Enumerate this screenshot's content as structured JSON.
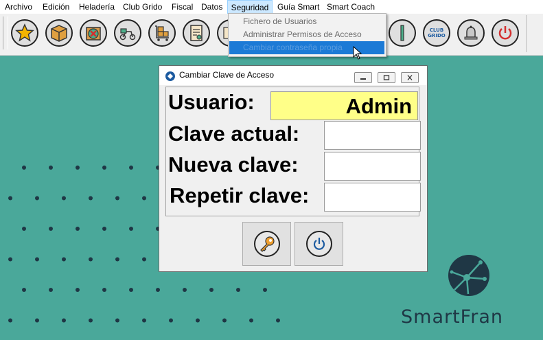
{
  "menu": {
    "items": [
      "Archivo",
      "Edición",
      "Heladería",
      "Club Grido",
      "Fiscal",
      "Datos",
      "Seguridad",
      "Guía Smart",
      "Smart Coach"
    ],
    "active": "Seguridad"
  },
  "seguridad_menu": {
    "items": [
      "Fichero de Usuarios",
      "Administrar Permisos de Acceso",
      "Cambiar contraseña propia"
    ],
    "highlighted": "Cambiar contraseña propia"
  },
  "toolbar": {
    "icons": [
      "star-icon",
      "box-icon",
      "cancel-box-icon",
      "delivery-scooter-icon",
      "boxes-cart-icon",
      "invoice-icon",
      "document-icon",
      "bar-icon",
      "club-grido-icon",
      "bell-icon",
      "power-icon"
    ],
    "club_label_line1": "CLUB",
    "club_label_line2": "GRIDO"
  },
  "dialog": {
    "title": "Cambiar Clave de Acceso",
    "usuario_label": "Usuario:",
    "usuario_value": "Admin",
    "clave_actual_label": "Clave actual:",
    "nueva_clave_label": "Nueva clave:",
    "repetir_clave_label": "Repetir clave:",
    "clave_actual_value": "",
    "nueva_clave_value": "",
    "repetir_clave_value": ""
  },
  "brand": {
    "name": "SmartFran"
  },
  "colors": {
    "background": "#4aa89a",
    "menu_highlight": "#1c7ad6",
    "user_field": "#ffff88",
    "brand_dark": "#1f3745"
  }
}
